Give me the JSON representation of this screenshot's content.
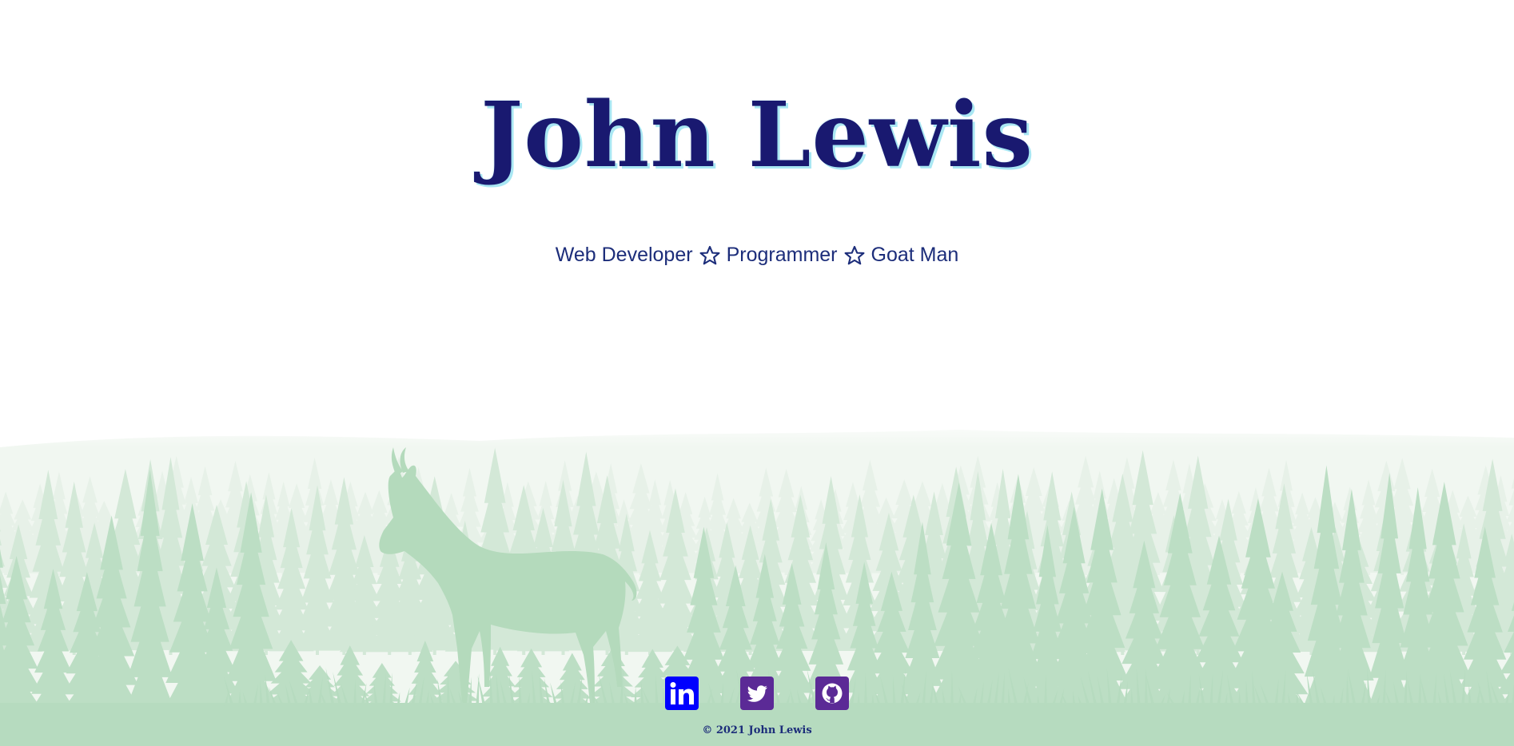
{
  "hero": {
    "name": "John Lewis",
    "tagline": [
      "Web Developer",
      "Programmer",
      "Goat Man"
    ],
    "separator_icon": "star-outline-icon"
  },
  "social": [
    {
      "name": "linkedin",
      "icon": "linkedin-icon",
      "color": "#0000ff"
    },
    {
      "name": "twitter",
      "icon": "twitter-icon",
      "color": "#5b2a96"
    },
    {
      "name": "github",
      "icon": "github-icon",
      "color": "#5b2a96"
    }
  ],
  "footer": {
    "copyright": "© 2021 John Lewis"
  },
  "colors": {
    "title": "#191970",
    "title_shadow": "#a9e7f3",
    "tagline": "#1c2d7a",
    "forest_light": "#e6f1e6",
    "forest_mid": "#cfe6d3",
    "forest_dark": "#b6dbbf",
    "goat": "#b4dabc"
  },
  "background": {
    "scene": "forest-silhouette",
    "animal": "goat-silhouette"
  }
}
